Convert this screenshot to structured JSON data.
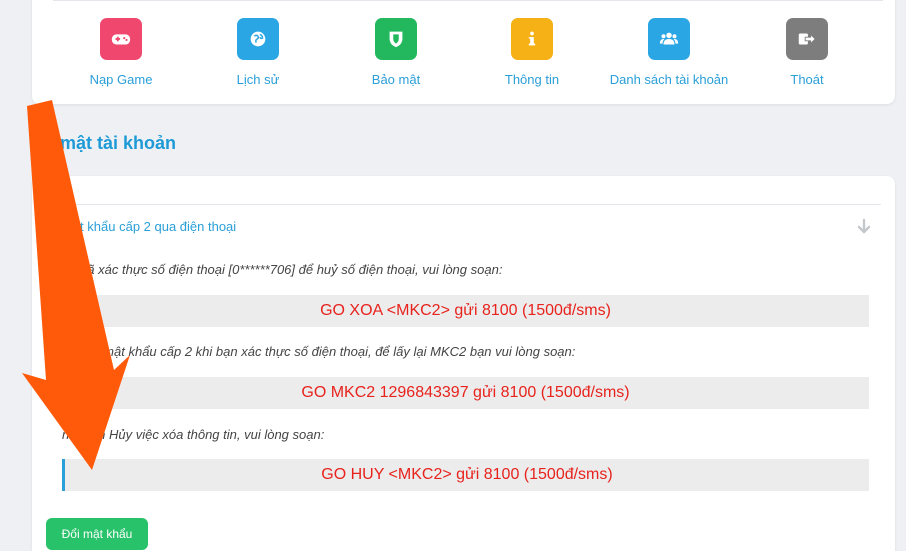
{
  "menu": {
    "items": [
      {
        "label": "Nạp Game",
        "icon": "gamepad-icon",
        "color": "#f0476f"
      },
      {
        "label": "Lịch sử",
        "icon": "globe-icon",
        "color": "#2aa6e4"
      },
      {
        "label": "Bảo mật",
        "icon": "shield-icon",
        "color": "#23b85e"
      },
      {
        "label": "Thông tin",
        "icon": "info-icon",
        "color": "#f5b116"
      },
      {
        "label": "Danh sách tài khoản",
        "icon": "users-icon",
        "color": "#2aa6e4"
      },
      {
        "label": "Thoát",
        "icon": "logout-icon",
        "color": "#7d7d7d"
      }
    ]
  },
  "section": {
    "title": "o mật tài khoản"
  },
  "panel": {
    "title": "Mật khẩu cấp 2 qua điện thoại",
    "note1": "ạn đã xác thực số điện thoại [0******706] để huỷ số điện thoại, vui lòng soạn:",
    "code1": "GO XOA <MKC2> gửi 8100 (1500đ/sms)",
    "note2": "C2 : là mật khẩu cấp 2 khi bạn xác thực số điện thoại, để lấy lại MKC2 bạn vui lòng soạn:",
    "code2": "GO MKC2 1296843397 gửi 8100 (1500đ/sms)",
    "note3": "n muốn Hủy việc xóa thông tin, vui lòng soạn:",
    "code3": "GO HUY <MKC2> gửi 8100 (1500đ/sms)",
    "button_label": "Đổi mật khẩu"
  },
  "colors": {
    "accent": "#2a9fd8",
    "code_text": "#e8221c",
    "button": "#27c26a",
    "arrow": "#ff5a0a"
  }
}
